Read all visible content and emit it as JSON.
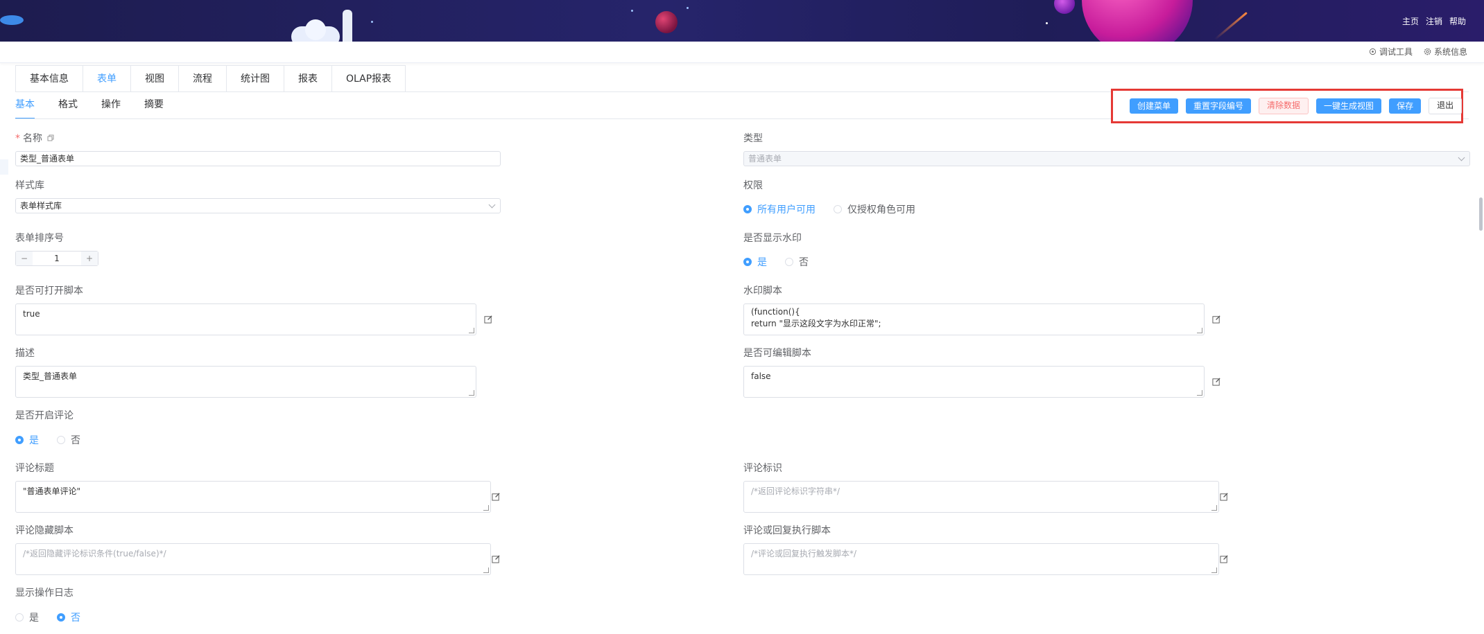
{
  "header": {
    "links": [
      "主页",
      "注销",
      "帮助"
    ]
  },
  "subbar": {
    "debug_tool": "调试工具",
    "system_info": "系统信息"
  },
  "main_tabs": [
    "基本信息",
    "表单",
    "视图",
    "流程",
    "统计图",
    "报表",
    "OLAP报表"
  ],
  "main_tabs_active": "表单",
  "sub_tabs": [
    "基本",
    "格式",
    "操作",
    "摘要"
  ],
  "sub_tabs_active": "基本",
  "actions": {
    "create_menu": "创建菜单",
    "reset_field_no": "重置字段编号",
    "clear_data": "清除数据",
    "gen_view": "一键生成视图",
    "save": "保存",
    "exit": "退出"
  },
  "form": {
    "name_label": "名称",
    "name_value": "类型_普通表单",
    "type_label": "类型",
    "type_value": "普通表单",
    "style_label": "样式库",
    "style_value": "表单样式库",
    "permission_label": "权限",
    "permission_options": [
      "所有用户可用",
      "仅授权角色可用"
    ],
    "order_label": "表单排序号",
    "order_value": "1",
    "watermark_show_label": "是否显示水印",
    "watermark_show_options": [
      "是",
      "否"
    ],
    "open_script_label": "是否可打开脚本",
    "open_script_value": "true",
    "watermark_script_label": "水印脚本",
    "watermark_script_value": "(function(){\nreturn \"显示这段文字为水印正常\";",
    "desc_label": "描述",
    "desc_value": "类型_普通表单",
    "edit_script_label": "是否可编辑脚本",
    "edit_script_value": "false",
    "comment_enable_label": "是否开启评论",
    "comment_enable_options": [
      "是",
      "否"
    ],
    "comment_title_label": "评论标题",
    "comment_title_value": "\"普通表单评论\"",
    "comment_id_label": "评论标识",
    "comment_id_placeholder": "/*返回评论标识字符串*/",
    "comment_hide_label": "评论隐藏脚本",
    "comment_hide_placeholder": "/*返回隐藏评论标识条件(true/false)*/",
    "comment_exec_label": "评论或回复执行脚本",
    "comment_exec_placeholder": "/*评论或回复执行触发脚本*/",
    "oplog_label": "显示操作日志",
    "oplog_options": [
      "是",
      "否"
    ]
  }
}
